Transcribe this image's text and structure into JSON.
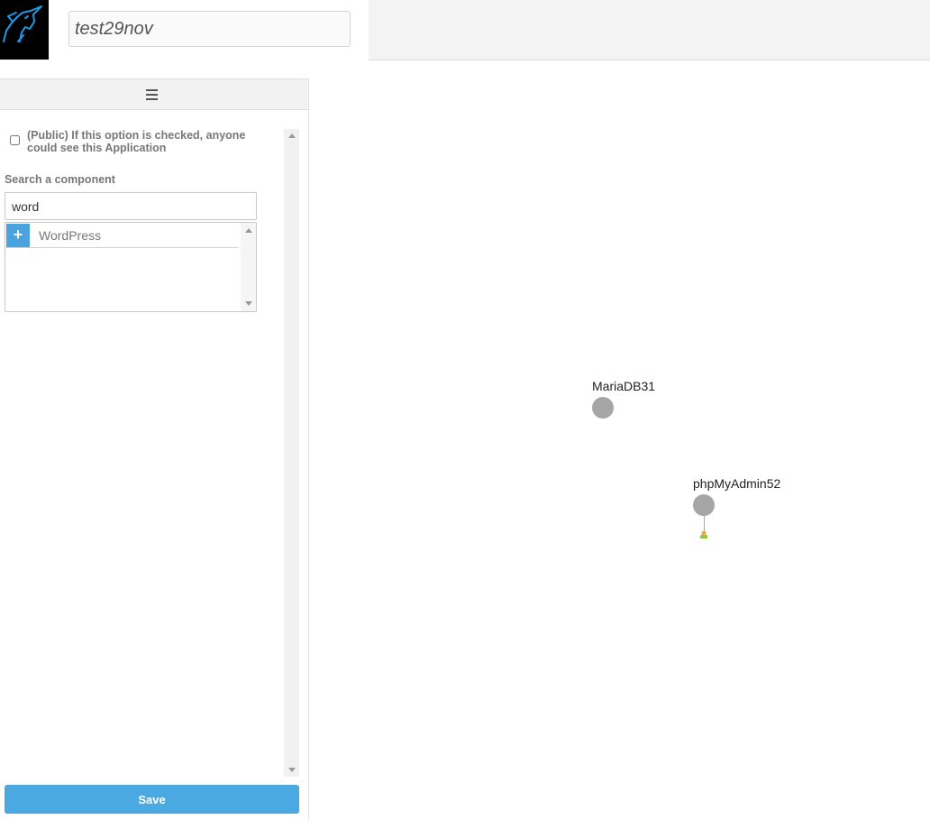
{
  "header": {
    "logo_icon": "unicorn-logo-icon",
    "app_name": "test29nov"
  },
  "sidebar": {
    "menu_icon": "hamburger-menu-icon",
    "public_option": {
      "checked": false,
      "label": "(Public) If this option is checked, anyone could see this Application"
    },
    "search": {
      "label": "Search a component",
      "value": "word",
      "results": [
        {
          "label": "WordPress",
          "action_icon": "plus-icon"
        }
      ]
    },
    "save_label": "Save"
  },
  "canvas": {
    "nodes": [
      {
        "label": "MariaDB31"
      },
      {
        "label": "phpMyAdmin52"
      }
    ]
  },
  "colors": {
    "accent": "#4aa9e0",
    "node": "#a6a6a6",
    "logo_bg": "#000000",
    "logo_stroke": "#1e9be8"
  }
}
